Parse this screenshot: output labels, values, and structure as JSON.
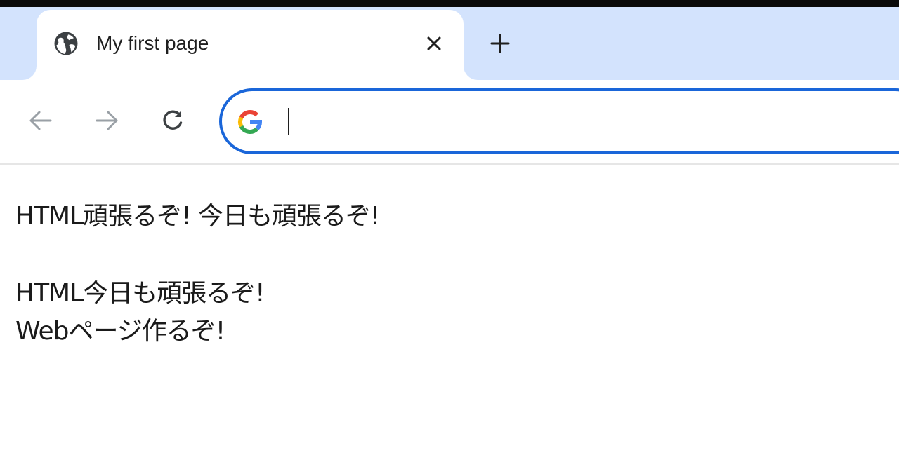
{
  "browser": {
    "tab": {
      "title": "My first page",
      "favicon": "globe-icon"
    },
    "icons": {
      "close": "close-icon",
      "new_tab": "plus-icon",
      "back": "arrow-left-icon",
      "forward": "arrow-right-icon",
      "reload": "reload-icon",
      "search_engine": "google-g-icon"
    },
    "omnibox": {
      "value": ""
    }
  },
  "page": {
    "paragraphs": [
      {
        "lines": [
          "HTML頑張るぞ! 今日も頑張るぞ!"
        ]
      },
      {
        "lines": [
          "HTML今日も頑張るぞ!",
          "Webページ作るぞ!"
        ]
      }
    ]
  },
  "colors": {
    "tab_strip": "#d3e3fd",
    "focus_ring": "#1a66d9",
    "text": "#1a1a1a"
  }
}
